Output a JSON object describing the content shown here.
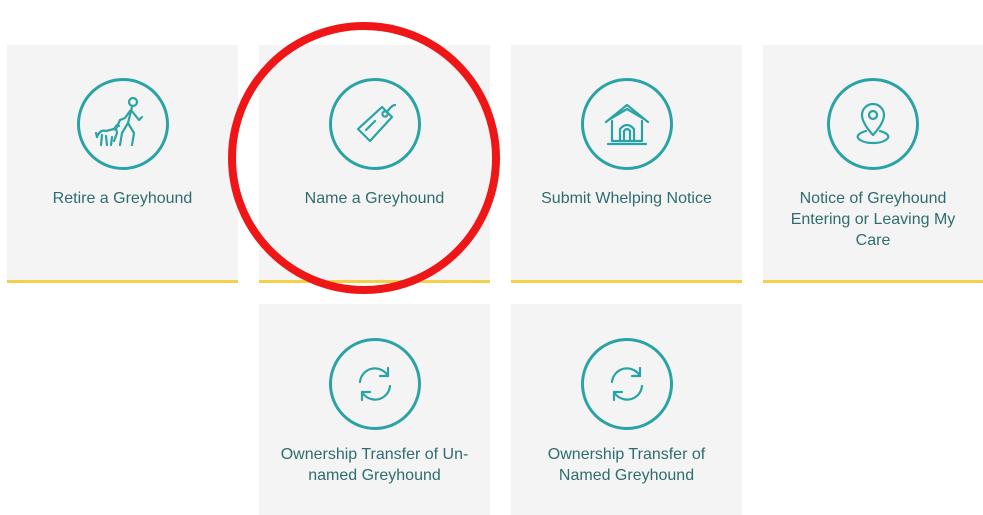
{
  "tiles": [
    {
      "label": "Retire a Greyhound",
      "icon": "dog-walker-icon"
    },
    {
      "label": "Name a Greyhound",
      "icon": "tag-icon"
    },
    {
      "label": "Submit Whelping Notice",
      "icon": "dog-house-icon"
    },
    {
      "label": "Notice of Greyhound Entering or Leaving My Care",
      "icon": "location-pin-icon"
    },
    {
      "label": "Ownership Transfer of Un-named Greyhound",
      "icon": "refresh-icon"
    },
    {
      "label": "Ownership Transfer of Named Greyhound",
      "icon": "refresh-icon"
    }
  ],
  "colors": {
    "accent": "#2aa3a6",
    "text": "#2f6c70",
    "tile_bg": "#f4f4f4",
    "underline": "#f4cf4a",
    "highlight": "#ee1616"
  }
}
